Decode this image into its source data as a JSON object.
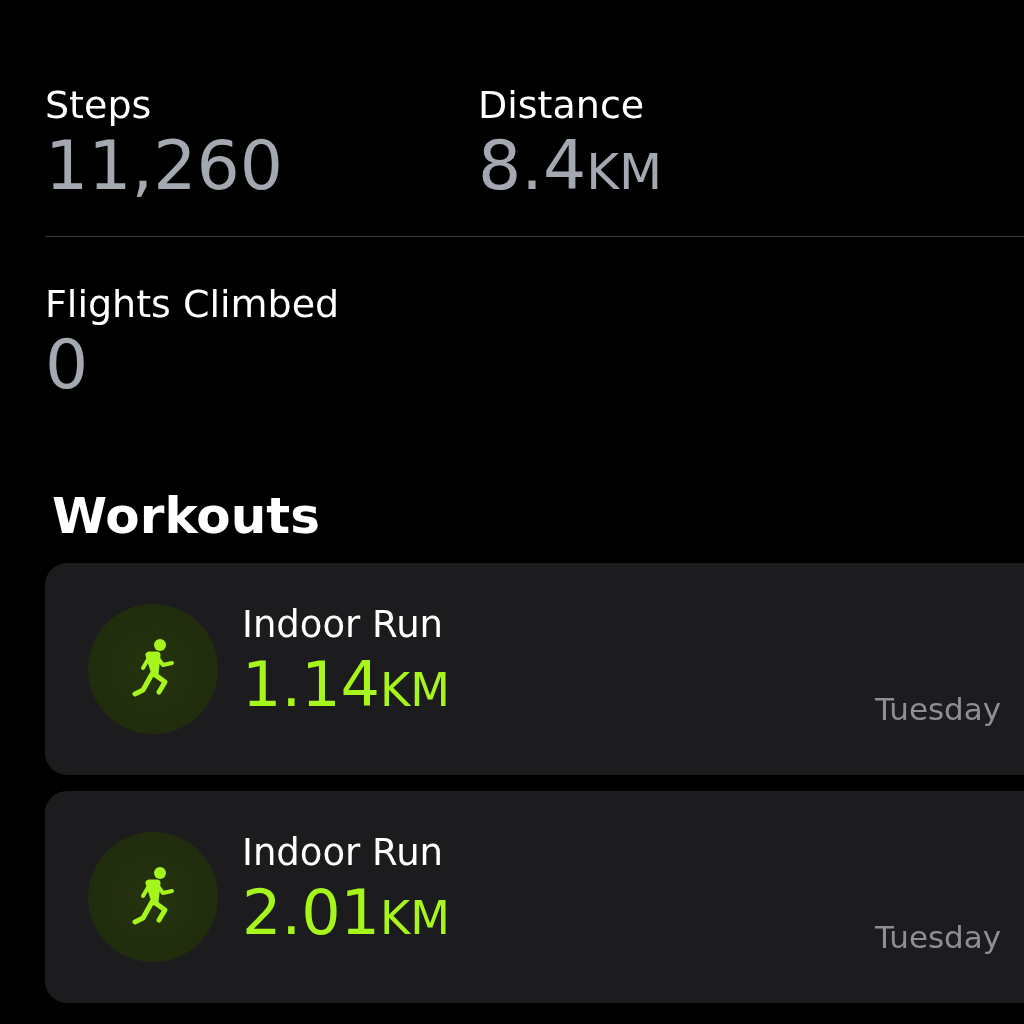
{
  "metrics": [
    {
      "label": "Steps",
      "value": "11,260"
    },
    {
      "label": "Distance",
      "value": "8.4",
      "unit": "KM"
    }
  ],
  "metrics_2": [
    {
      "label": "Flights Climbed",
      "value": "0"
    }
  ],
  "workouts": {
    "title": "Workouts",
    "items": [
      {
        "name": "Indoor Run",
        "value": "1.14",
        "unit": "KM",
        "day": "Tuesday"
      },
      {
        "name": "Indoor Run",
        "value": "2.01",
        "unit": "KM",
        "day": "Tuesday"
      }
    ]
  }
}
